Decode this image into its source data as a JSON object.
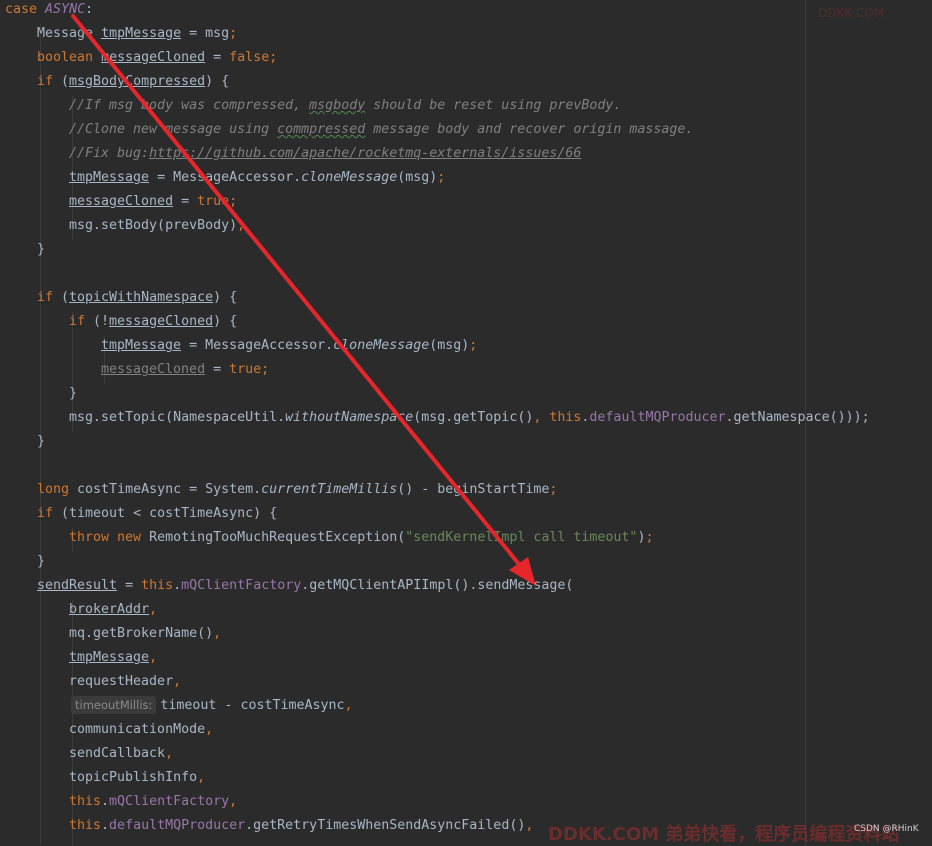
{
  "code": {
    "keywords": {
      "case": "case",
      "boolean": "boolean",
      "if": "if",
      "false": "false",
      "true": "true",
      "long": "long",
      "throw": "throw",
      "new": "new",
      "this": "this"
    },
    "lines": {
      "l1_const": "ASYNC",
      "l2_type": "Message",
      "l2_var": "tmpMessage",
      "l2_rest": " = msg",
      "l3_var": "messageCloned",
      "l4_var": "msgBodyCompressed",
      "c1a": "//If msg body was compressed, ",
      "c1b": "msgbody",
      "c1c": " should be reset using prevBody.",
      "c2a": "//Clone new message using ",
      "c2b": "commpressed",
      "c2c": " message body and recover origin massage.",
      "c3a": "//Fix bug:",
      "c3b": "https://github.com/apache/rocketmq-externals/issues/66",
      "l8_a": " = MessageAccessor.",
      "l8_m": "cloneMessage",
      "l8_b": "(msg)",
      "l10": "msg.setBody(prevBody)",
      "l13_var": "topicWithNamespace",
      "l16_ns_a": "msg.setTopic(NamespaceUtil.",
      "l16_ns_m": "withoutNamespace",
      "l16_ns_b": "(msg.getTopic()",
      "l16_field": "defaultMQProducer",
      "l16_tail": ".getNamespace()));",
      "l20_a": " costTimeAsync = System.",
      "l20_m": "currentTimeMillis",
      "l20_b": "() - beginStartTime",
      "l21": " (timeout < costTimeAsync) {",
      "l22_cls": " RemotingTooMuchRequestException(",
      "l22_str": "\"sendKernelImpl call timeout\"",
      "l24_var": "sendResult",
      "l24_field": "mQClientFactory",
      "l24_rest": ".getMQClientAPIImpl().sendMessage(",
      "l25": "brokerAddr",
      "l26": "mq.getBrokerName()",
      "l27": "tmpMessage",
      "l28": "requestHeader",
      "l29_hint": "timeoutMillis:",
      "l29": "timeout - costTimeAsync",
      "l30": "communicationMode",
      "l31": "sendCallback",
      "l32": "topicPublishInfo",
      "l33_field": "mQClientFactory",
      "l34_field": "defaultMQProducer",
      "l34_rest": ".getRetryTimesWhenSendAsyncFailed()"
    }
  },
  "overlay": {
    "watermark": "DDKK.COM 弟弟快看，程序员编程资料站",
    "corner_mark": "DDKK.COM",
    "small_note": "CSDN @RHinK"
  },
  "colors": {
    "background": "#2b2b2b",
    "keyword": "#cc7832",
    "field": "#9876aa",
    "string": "#6a8759",
    "comment": "#808080",
    "text": "#a9b7c6",
    "arrow": "#e5262b"
  }
}
